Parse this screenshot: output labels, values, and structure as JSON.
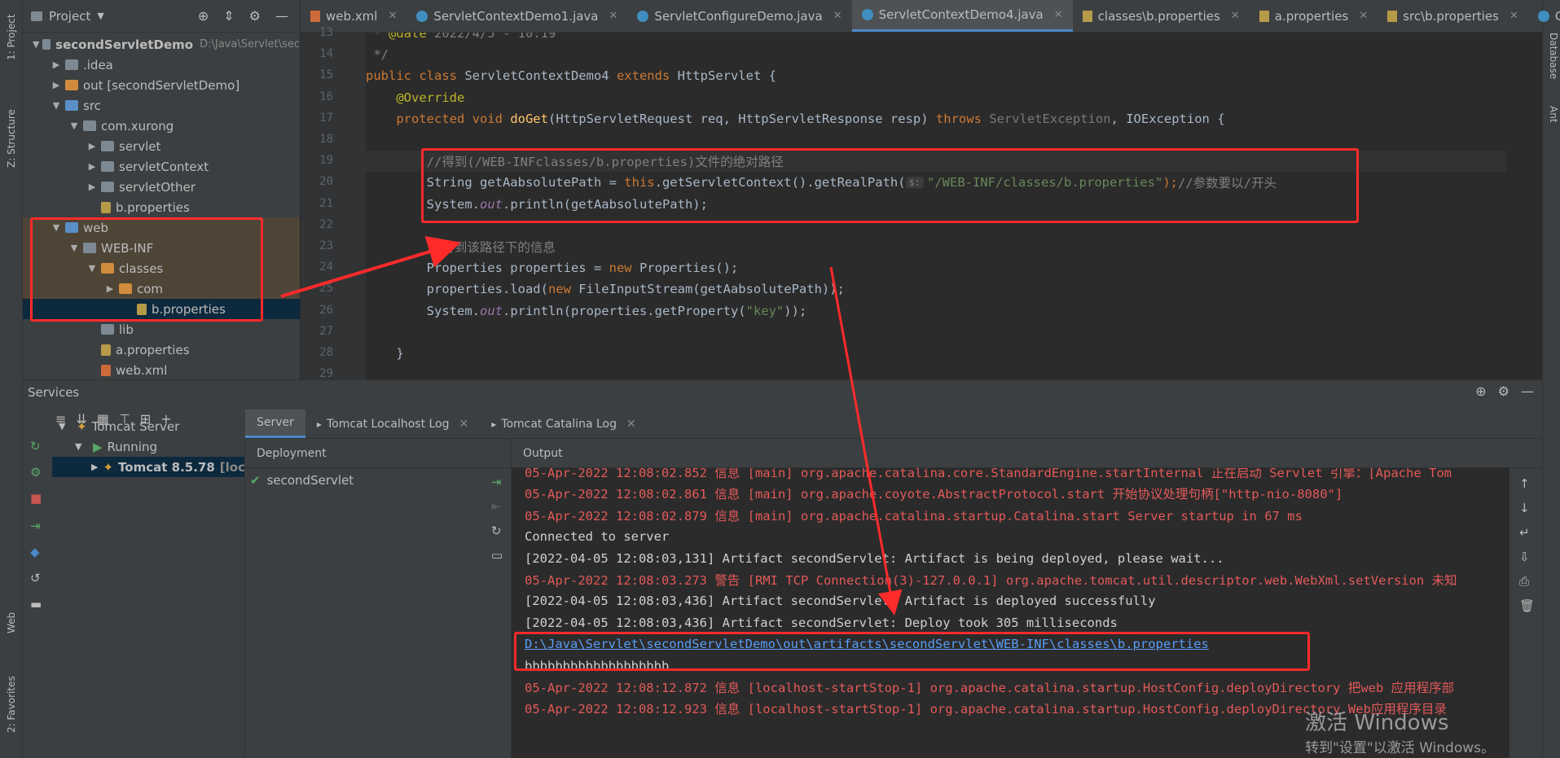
{
  "left_strip": {
    "tabs": [
      "1: Project",
      "Z: Structure",
      "Web",
      "2: Favorites"
    ]
  },
  "right_strip": {
    "tabs": [
      "Database",
      "Ant"
    ]
  },
  "project": {
    "title": "Project",
    "tree": [
      {
        "label": "secondServletDemo",
        "suffix": "D:\\Java\\Servlet\\sec",
        "indent": 0,
        "arrow": "▼",
        "icon": "folder",
        "bold": true
      },
      {
        "label": ".idea",
        "indent": 1,
        "arrow": "▶",
        "icon": "folder"
      },
      {
        "label": "out [secondServletDemo]",
        "indent": 1,
        "arrow": "▶",
        "icon": "folder-orange"
      },
      {
        "label": "src",
        "indent": 1,
        "arrow": "▼",
        "icon": "folder-blue"
      },
      {
        "label": "com.xurong",
        "indent": 2,
        "arrow": "▼",
        "icon": "folder"
      },
      {
        "label": "servlet",
        "indent": 3,
        "arrow": "▶",
        "icon": "folder"
      },
      {
        "label": "servletContext",
        "indent": 3,
        "arrow": "▶",
        "icon": "folder"
      },
      {
        "label": "servletOther",
        "indent": 3,
        "arrow": "▶",
        "icon": "folder"
      },
      {
        "label": "b.properties",
        "indent": 3,
        "arrow": "",
        "icon": "file-prop"
      },
      {
        "label": "web",
        "indent": 1,
        "arrow": "▼",
        "icon": "folder-blue"
      },
      {
        "label": "WEB-INF",
        "indent": 2,
        "arrow": "▼",
        "icon": "folder"
      },
      {
        "label": "classes",
        "indent": 3,
        "arrow": "▼",
        "icon": "folder-orange"
      },
      {
        "label": "com",
        "indent": 4,
        "arrow": "▶",
        "icon": "folder-orange"
      },
      {
        "label": "b.properties",
        "indent": 5,
        "arrow": "",
        "icon": "file-prop",
        "selected": true
      },
      {
        "label": "lib",
        "indent": 3,
        "arrow": "",
        "icon": "folder"
      },
      {
        "label": "a.properties",
        "indent": 3,
        "arrow": "",
        "icon": "file-prop"
      },
      {
        "label": "web.xml",
        "indent": 3,
        "arrow": "",
        "icon": "file-xml"
      }
    ]
  },
  "editor_tabs": [
    {
      "label": "web.xml",
      "icon": "xml-icon"
    },
    {
      "label": "ServletContextDemo1.java",
      "icon": "class-icon"
    },
    {
      "label": "ServletConfigureDemo.java",
      "icon": "class-icon"
    },
    {
      "label": "ServletContextDemo4.java",
      "icon": "class-icon",
      "active": true
    },
    {
      "label": "classes\\b.properties",
      "icon": "properties-icon"
    },
    {
      "label": "a.properties",
      "icon": "properties-icon"
    },
    {
      "label": "src\\b.properties",
      "icon": "properties-icon"
    },
    {
      "label": "G",
      "icon": "class-icon"
    }
  ],
  "code": {
    "line_numbers": [
      "13",
      "14",
      "15",
      "16",
      "17",
      "18",
      "19",
      "20",
      "21",
      "22",
      "23",
      "24",
      "25",
      "26",
      "27",
      "28",
      "29"
    ],
    "lines": [
      [
        {
          "t": " * ",
          "c": "cm"
        },
        {
          "t": "@date",
          "c": "ann"
        },
        {
          "t": " 2022/4/5 - 10:19",
          "c": "cm"
        }
      ],
      [
        {
          "t": " */",
          "c": "cm"
        }
      ],
      [
        {
          "t": "public class ",
          "c": "kw"
        },
        {
          "t": "ServletContextDemo4 ",
          "c": "txt"
        },
        {
          "t": "extends ",
          "c": "kw"
        },
        {
          "t": "HttpServlet {",
          "c": "txt"
        }
      ],
      [
        {
          "t": "    @Override",
          "c": "ann"
        }
      ],
      [
        {
          "t": "    protected void ",
          "c": "kw"
        },
        {
          "t": "doGet",
          "c": "fn"
        },
        {
          "t": "(HttpServletRequest req, HttpServletResponse resp) ",
          "c": "txt"
        },
        {
          "t": "throws ",
          "c": "kw"
        },
        {
          "t": "ServletException",
          "c": "grey"
        },
        {
          "t": ", IOException {",
          "c": "txt"
        }
      ],
      [
        {
          "t": "",
          "c": "txt"
        }
      ],
      [
        {
          "t": "        //得到(/WEB-INFclasses/b.properties)文件的绝对路径",
          "c": "cm"
        }
      ],
      [
        {
          "t": "        String getAabsolutePath = ",
          "c": "txt"
        },
        {
          "t": "this",
          "c": "kw"
        },
        {
          "t": ".getServletContext().getRealPath(",
          "c": "txt"
        },
        {
          "t": "s:",
          "c": "hint"
        },
        {
          "t": "\"/WEB-INF/classes/b.properties\"",
          "c": "str"
        },
        {
          "t": ");",
          "c": "kw"
        },
        {
          "t": "//参数要以/开头",
          "c": "cm"
        }
      ],
      [
        {
          "t": "        System.",
          "c": "txt"
        },
        {
          "t": "out",
          "c": "fld"
        },
        {
          "t": ".println(getAabsolutePath);",
          "c": "txt"
        }
      ],
      [
        {
          "t": "",
          "c": "txt"
        }
      ],
      [
        {
          "t": "        //得到该路径下的信息",
          "c": "cm"
        }
      ],
      [
        {
          "t": "        Properties properties = ",
          "c": "txt"
        },
        {
          "t": "new ",
          "c": "kw"
        },
        {
          "t": "Properties();",
          "c": "txt"
        }
      ],
      [
        {
          "t": "        properties.load(",
          "c": "txt"
        },
        {
          "t": "new ",
          "c": "kw"
        },
        {
          "t": "FileInputStream(getAabsolutePath));",
          "c": "txt"
        }
      ],
      [
        {
          "t": "        System.",
          "c": "txt"
        },
        {
          "t": "out",
          "c": "fld"
        },
        {
          "t": ".println(properties.getProperty(",
          "c": "txt"
        },
        {
          "t": "\"key\"",
          "c": "str"
        },
        {
          "t": "));",
          "c": "txt"
        }
      ],
      [
        {
          "t": "",
          "c": "txt"
        }
      ],
      [
        {
          "t": "    }",
          "c": "txt"
        }
      ],
      [
        {
          "t": "",
          "c": "txt"
        }
      ]
    ]
  },
  "services": {
    "title": "Services",
    "tree": [
      {
        "label": "Tomcat Server",
        "indent": 0,
        "arrow": "▼"
      },
      {
        "label": "Running",
        "indent": 1,
        "arrow": "▼"
      },
      {
        "label": "Tomcat 8.5.78",
        "suffix": "[loca",
        "indent": 2,
        "arrow": "▶",
        "selected": true
      }
    ],
    "detail_tabs": [
      "Server",
      "Tomcat Localhost Log",
      "Tomcat Catalina Log"
    ],
    "deployment_header": "Deployment",
    "deployment_item": "secondServlet",
    "output_header": "Output",
    "output": [
      {
        "t": "05-Apr-2022 12:08:02.852 信息 [main] org.apache.catalina.core.StandardEngine.startInternal 正在启动 Servlet 引擎：[Apache Tom",
        "c": "red"
      },
      {
        "t": "05-Apr-2022 12:08:02.861 信息 [main] org.apache.coyote.AbstractProtocol.start 开始协议处理句柄[\"http-nio-8080\"]",
        "c": "red"
      },
      {
        "t": "05-Apr-2022 12:08:02.879 信息 [main] org.apache.catalina.startup.Catalina.start Server startup in 67 ms",
        "c": "red"
      },
      {
        "t": "Connected to server",
        "c": "wh"
      },
      {
        "t": "[2022-04-05 12:08:03,131] Artifact secondServlet: Artifact is being deployed, please wait...",
        "c": "wh"
      },
      {
        "t": "05-Apr-2022 12:08:03.273 警告 [RMI TCP Connection(3)-127.0.0.1] org.apache.tomcat.util.descriptor.web.WebXml.setVersion 未知",
        "c": "red"
      },
      {
        "t": "[2022-04-05 12:08:03,436] Artifact secondServlet: Artifact is deployed successfully",
        "c": "wh"
      },
      {
        "t": "[2022-04-05 12:08:03,436] Artifact secondServlet: Deploy took 305 milliseconds",
        "c": "wh"
      },
      {
        "t": "D:\\Java\\Servlet\\secondServletDemo\\out\\artifacts\\secondServlet\\WEB-INF\\classes\\b.properties",
        "c": "lnk"
      },
      {
        "t": "bbbbbbbbbbbbbbbbbbb",
        "c": "wh"
      },
      {
        "t": "05-Apr-2022 12:08:12.872 信息 [localhost-startStop-1] org.apache.catalina.startup.HostConfig.deployDirectory 把web 应用程序部",
        "c": "red"
      },
      {
        "t": "05-Apr-2022 12:08:12.923 信息 [localhost-startStop-1] org.apache.catalina.startup.HostConfig.deployDirectory Web应用程序目录",
        "c": "red"
      }
    ]
  },
  "watermark": {
    "line1": "激活 Windows",
    "line2": "转到\"设置\"以激活 Windows。"
  },
  "colors": {
    "highlight_box": "#ff2b2b",
    "accent": "#4a88c7",
    "bg": "#2b2b2b"
  }
}
